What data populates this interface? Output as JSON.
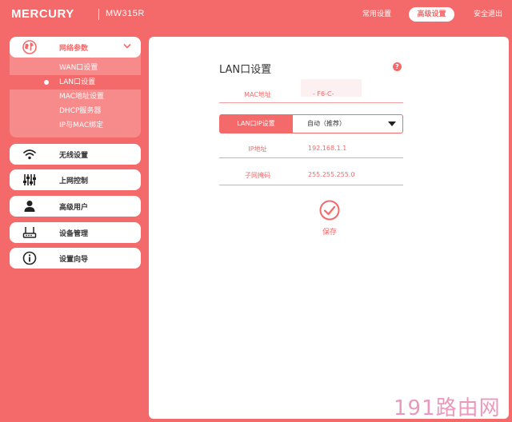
{
  "header": {
    "brand": "MERCURY",
    "model": "MW315R",
    "nav": [
      "常用设置",
      "高级设置",
      "安全退出"
    ]
  },
  "sidebar": {
    "group": {
      "label": "网络参数",
      "icon": "globe-icon",
      "items": [
        "WAN口设置",
        "LAN口设置",
        "MAC地址设置",
        "DHCP服务器",
        "IP与MAC绑定"
      ],
      "active": "LAN口设置"
    },
    "items": [
      {
        "label": "无线设置",
        "icon": "wifi-icon"
      },
      {
        "label": "上网控制",
        "icon": "sliders-icon"
      },
      {
        "label": "高级用户",
        "icon": "user-icon"
      },
      {
        "label": "设备管理",
        "icon": "router-icon"
      },
      {
        "label": "设置向导",
        "icon": "info-icon"
      }
    ]
  },
  "main": {
    "title": "LAN口设置",
    "help": "?",
    "mac": {
      "label": "MAC地址",
      "value": "- F6-C-"
    },
    "mode": {
      "label": "LAN口IP设置",
      "value": "自动（推荐）"
    },
    "ip": {
      "label": "IP地址",
      "value": "192.168.1.1"
    },
    "mask": {
      "label": "子网掩码",
      "value": "255.255.255.0"
    },
    "save_label": "保存"
  },
  "watermark": "191路由网",
  "colors": {
    "accent": "#f46a6a",
    "panel": "#ffffff",
    "submenu": "#f78a8a"
  }
}
